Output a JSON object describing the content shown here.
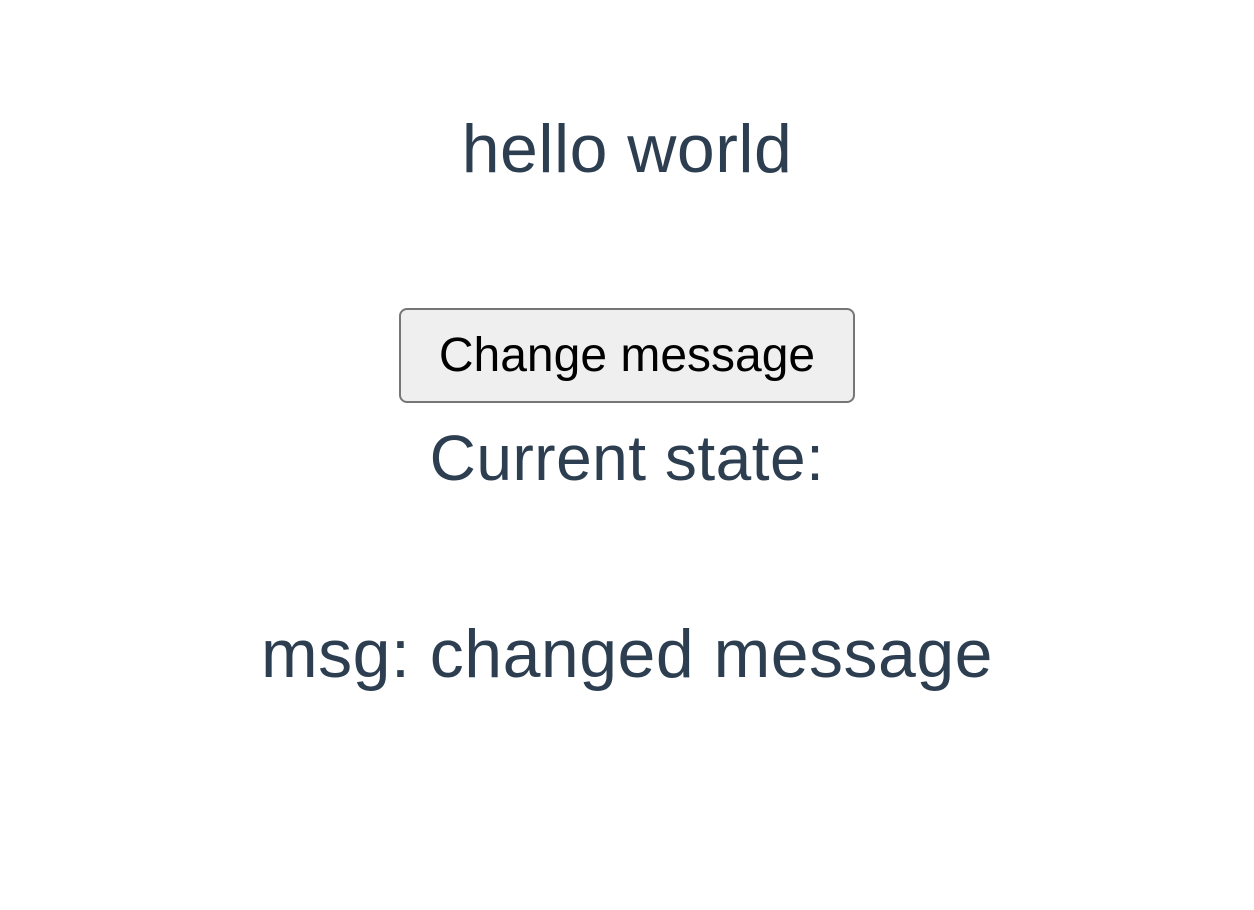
{
  "heading": "hello world",
  "button_label": "Change message",
  "state_label": "Current state:",
  "state_value": "msg: changed message"
}
